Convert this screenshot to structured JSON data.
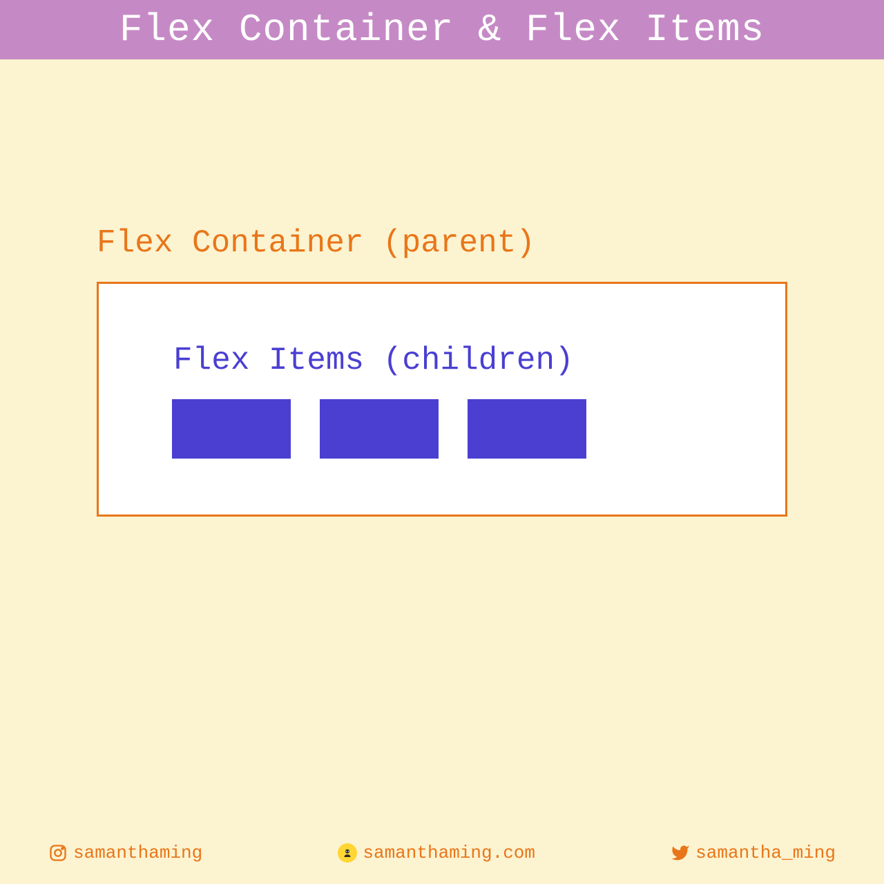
{
  "header": {
    "title": "Flex Container & Flex Items"
  },
  "diagram": {
    "container_label": "Flex Container (parent)",
    "items_label": "Flex Items (children)"
  },
  "footer": {
    "instagram": "samanthaming",
    "website": "samanthaming.com",
    "twitter": "samantha_ming"
  },
  "colors": {
    "header_bg": "#c58ac5",
    "page_bg": "#fcf3d0",
    "orange": "#e8761a",
    "purple": "#4a3fd1"
  }
}
